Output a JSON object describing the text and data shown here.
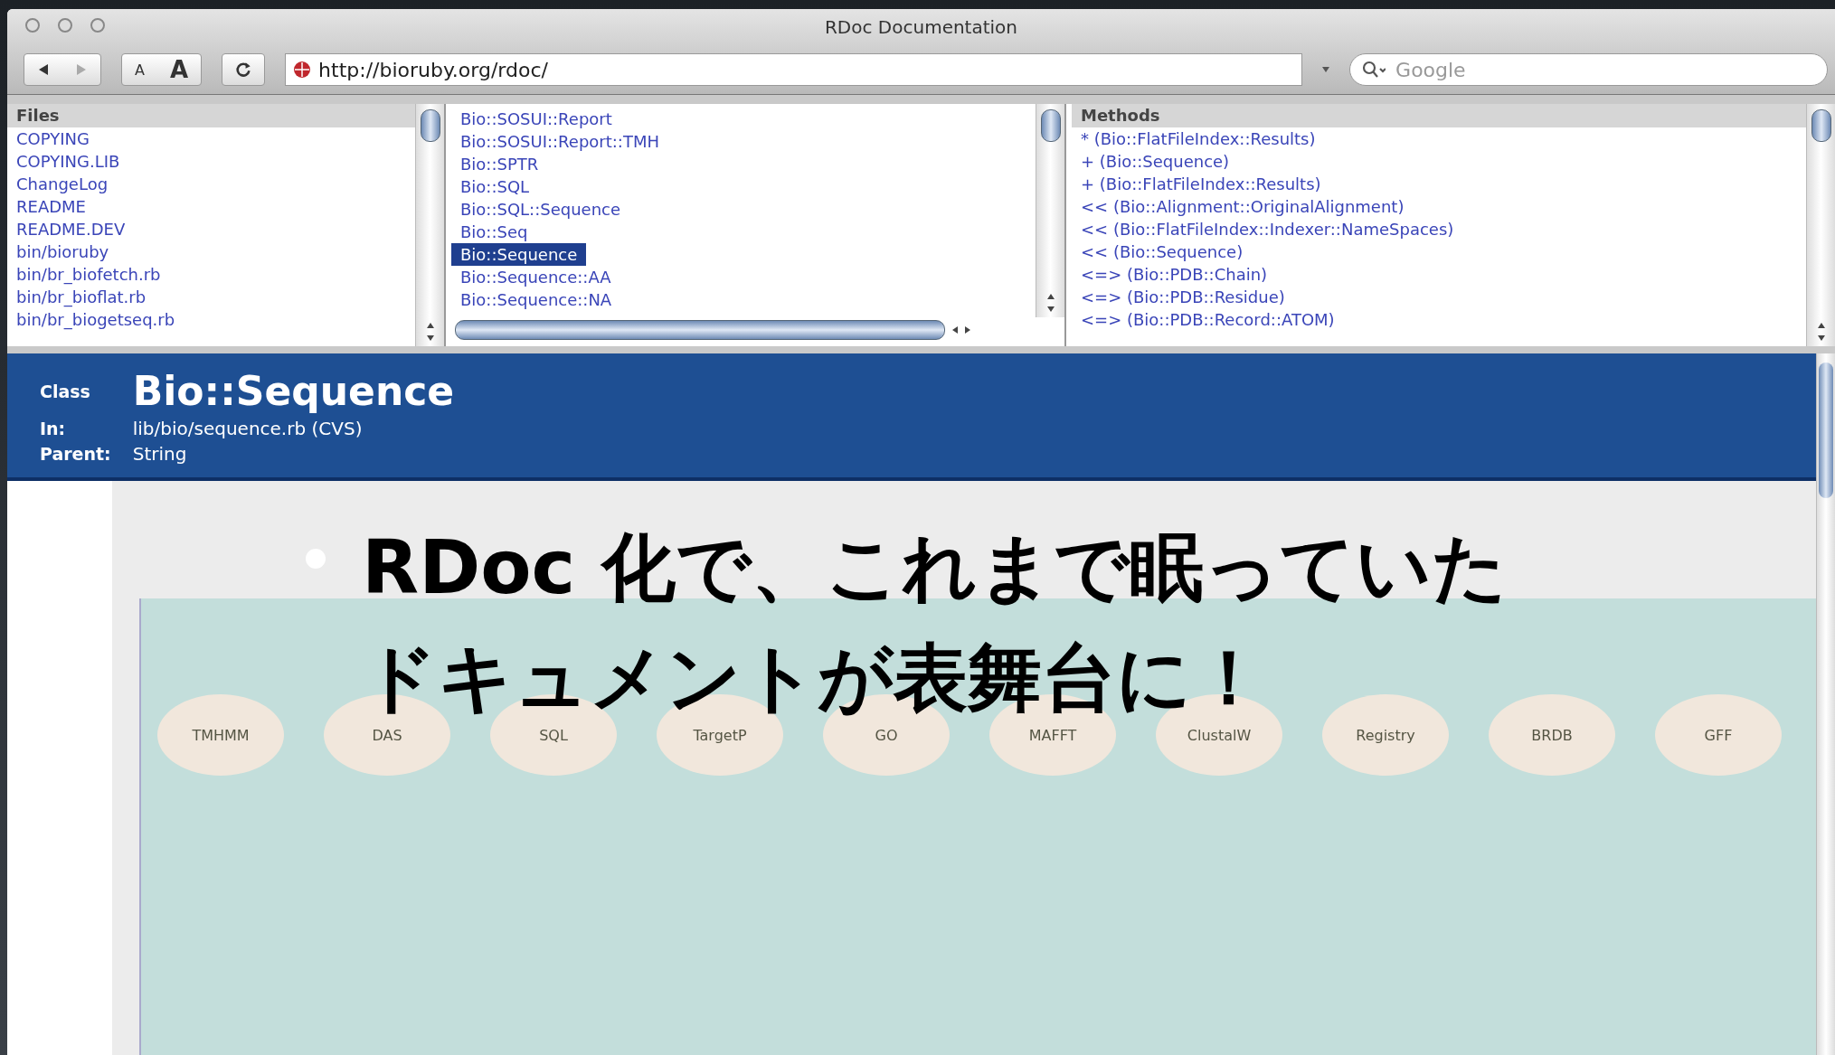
{
  "window": {
    "title": "RDoc Documentation"
  },
  "toolbar": {
    "font_buttons": [
      "A",
      "A"
    ],
    "url": "http://bioruby.org/rdoc/",
    "search": {
      "placeholder": "Google"
    }
  },
  "files": {
    "heading": "Files",
    "items": [
      "COPYING",
      "COPYING.LIB",
      "ChangeLog",
      "README",
      "README.DEV",
      "bin/bioruby",
      "bin/br_biofetch.rb",
      "bin/br_bioflat.rb",
      "bin/br_biogetseq.rb"
    ]
  },
  "classes": {
    "items": [
      {
        "label": "Bio::SOSUI::Report",
        "selected": false
      },
      {
        "label": "Bio::SOSUI::Report::TMH",
        "selected": false
      },
      {
        "label": "Bio::SPTR",
        "selected": false
      },
      {
        "label": "Bio::SQL",
        "selected": false
      },
      {
        "label": "Bio::SQL::Sequence",
        "selected": false
      },
      {
        "label": "Bio::Seq",
        "selected": false
      },
      {
        "label": "Bio::Sequence",
        "selected": true
      },
      {
        "label": "Bio::Sequence::AA",
        "selected": false
      },
      {
        "label": "Bio::Sequence::NA",
        "selected": false
      }
    ]
  },
  "methods": {
    "heading": "Methods",
    "items": [
      "* (Bio::FlatFileIndex::Results)",
      "+ (Bio::Sequence)",
      "+ (Bio::FlatFileIndex::Results)",
      "<< (Bio::Alignment::OriginalAlignment)",
      "<< (Bio::FlatFileIndex::Indexer::NameSpaces)",
      "<< (Bio::Sequence)",
      "<=> (Bio::PDB::Chain)",
      "<=> (Bio::PDB::Residue)",
      "<=> (Bio::PDB::Record::ATOM)"
    ]
  },
  "class_header": {
    "kind_label": "Class",
    "name": "Bio::Sequence",
    "in_label": "In:",
    "in_value": "lib/bio/sequence.rb  (CVS)",
    "parent_label": "Parent:",
    "parent_value": "String"
  },
  "diagram": {
    "nodes": [
      "TMHMM",
      "DAS",
      "SQL",
      "TargetP",
      "GO",
      "MAFFT",
      "ClustalW",
      "Registry",
      "BRDB",
      "GFF"
    ]
  },
  "slide_text": {
    "lines": [
      "RDoc 化で、これまで眠っていた",
      "ドキュメントが表舞台に！"
    ]
  }
}
